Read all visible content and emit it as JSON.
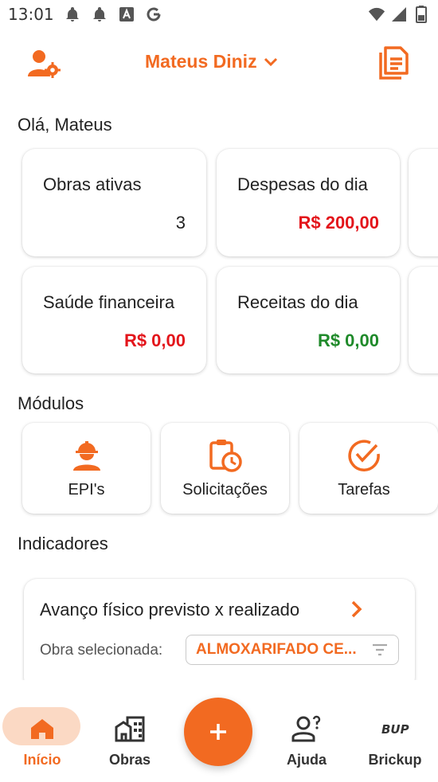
{
  "status_bar": {
    "time": "13:01"
  },
  "header": {
    "user_name": "Mateus Diniz"
  },
  "greeting": "Olá, Mateus",
  "summary_cards": [
    {
      "title": "Obras ativas",
      "value": "3"
    },
    {
      "title": "Despesas do dia",
      "value": "R$ 200,00"
    },
    {
      "title": "Saúde financeira",
      "value": "R$ 0,00"
    },
    {
      "title": "Receitas do dia",
      "value": "R$ 0,00"
    }
  ],
  "modules": {
    "title": "Módulos",
    "items": [
      {
        "label": "EPI's",
        "icon": "worker-helmet-icon"
      },
      {
        "label": "Solicitações",
        "icon": "clipboard-clock-icon"
      },
      {
        "label": "Tarefas",
        "icon": "check-circle-icon"
      }
    ]
  },
  "indicators": {
    "title": "Indicadores",
    "card_title": "Avanço físico previsto x realizado",
    "select_label": "Obra selecionada:",
    "select_value": "ALMOXARIFADO CE..."
  },
  "bottom_nav": [
    {
      "label": "Início",
      "icon": "home-icon",
      "active": true
    },
    {
      "label": "Obras",
      "icon": "buildings-icon",
      "active": false
    },
    {
      "label": "Ajuda",
      "icon": "help-person-icon",
      "active": false
    },
    {
      "label": "Brickup",
      "icon": "brickup-logo-icon",
      "active": false
    }
  ],
  "colors": {
    "accent": "#f26a21",
    "negative": "#e3151b",
    "positive": "#1f8a2a",
    "nav_pill": "#fbd9c4"
  }
}
